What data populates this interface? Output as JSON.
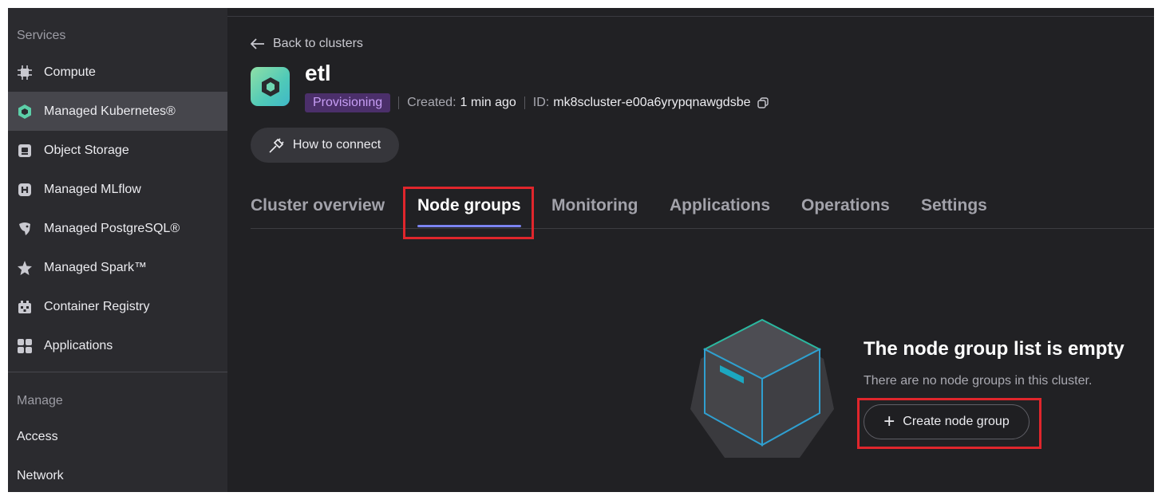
{
  "sidebar": {
    "section_services": "Services",
    "items": [
      {
        "label": "Compute",
        "icon": "compute-icon"
      },
      {
        "label": "Managed Kubernetes®",
        "icon": "kubernetes-icon"
      },
      {
        "label": "Object Storage",
        "icon": "object-storage-icon"
      },
      {
        "label": "Managed MLflow",
        "icon": "mlflow-icon"
      },
      {
        "label": "Managed PostgreSQL®",
        "icon": "postgresql-icon"
      },
      {
        "label": "Managed Spark™",
        "icon": "spark-icon"
      },
      {
        "label": "Container Registry",
        "icon": "container-registry-icon"
      },
      {
        "label": "Applications",
        "icon": "applications-icon"
      }
    ],
    "section_manage": "Manage",
    "manage_items": [
      "Access",
      "Network"
    ]
  },
  "header": {
    "back_label": "Back to clusters",
    "cluster_name": "etl",
    "status": "Provisioning",
    "created_label": "Created:",
    "created_value": "1 min ago",
    "id_label": "ID:",
    "id_value": "mk8scluster-e00a6yrypqnawgdsbe",
    "how_to_connect": "How to connect"
  },
  "tabs": [
    "Cluster overview",
    "Node groups",
    "Monitoring",
    "Applications",
    "Operations",
    "Settings"
  ],
  "active_tab": "Node groups",
  "empty_state": {
    "title": "The node group list is empty",
    "subtitle": "There are no node groups in this cluster.",
    "button_label": "Create node group"
  },
  "colors": {
    "status_badge_bg": "#4b2f6a",
    "status_badge_text": "#c79ef5",
    "tab_underline": "#7b83f0",
    "highlight_box": "#e0262c"
  }
}
